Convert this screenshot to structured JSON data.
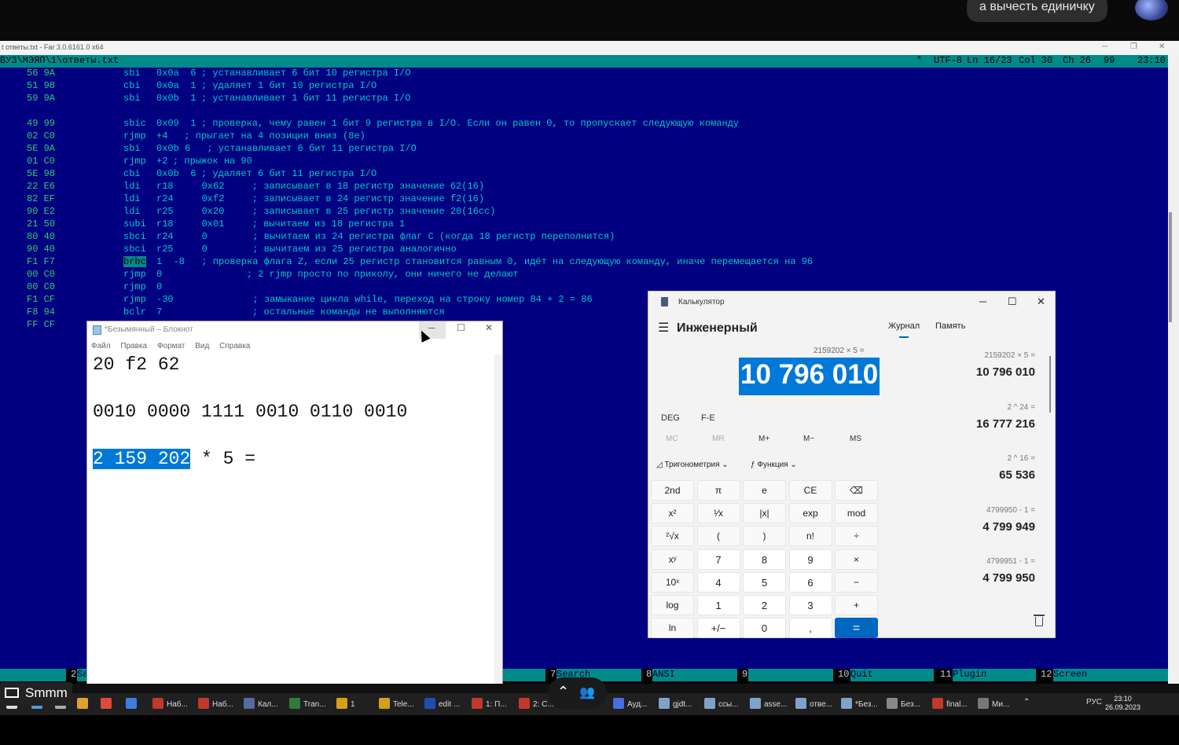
{
  "overlay": {
    "chat_text": "а вычесть единичку"
  },
  "far": {
    "window_title": "t ответы.txt - Far 3.0.6161.0 x64",
    "path": "ВУЗ\\МЭЯП\\1\\ответы.txt",
    "status": {
      "mod": "*",
      "encoding": "UTF-8",
      "line": "Ln 16/23",
      "col": "Col 30",
      "ch": "Ch 26",
      "num": "99",
      "time": "23:10"
    },
    "lines": [
      {
        "hex": "56 9A",
        "mn": "sbi",
        "ops": "0x0a  6",
        "comment": "; устанавливает 6 бит 10 регистра I/O"
      },
      {
        "hex": "51 98",
        "mn": "cbi",
        "ops": "0x0a  1",
        "comment": "; удаляет 1 бит 10 регистра I/O"
      },
      {
        "hex": "59 9A",
        "mn": "sbi",
        "ops": "0x0b  1",
        "comment": "; устанавливает 1 бит 11 регистра I/O"
      },
      {
        "hex": "",
        "mn": "",
        "ops": "",
        "comment": ""
      },
      {
        "hex": "49 99",
        "mn": "sbic",
        "ops": "0x09  1",
        "comment": "; проверка, чему равен 1 бит 9 регистра в I/O. Если он равен 0, то пропускает следующую команду"
      },
      {
        "hex": "02 C0",
        "mn": "rjmp",
        "ops": "+4",
        "comment": "  ; прыгает на 4 позиции вниз (8e)"
      },
      {
        "hex": "5E 9A",
        "mn": "sbi",
        "ops": "0x0b 6",
        "comment": "  ; устанавливает 6 бит 11 регистра I/O"
      },
      {
        "hex": "01 C0",
        "mn": "rjmp",
        "ops": "+2",
        "comment": "; прыжок на 90"
      },
      {
        "hex": "5E 98",
        "mn": "cbi",
        "ops": "0x0b  6",
        "comment": "; удаляет 6 бит 11 регистра I/O"
      },
      {
        "hex": "22 E6",
        "mn": "ldi",
        "ops": "r18     0x62",
        "comment": "    ; записывает в 18 регистр значение 62(16)"
      },
      {
        "hex": "82 EF",
        "mn": "ldi",
        "ops": "r24     0xf2",
        "comment": "    ; записывает в 24 регистр значение f2(16)"
      },
      {
        "hex": "90 E2",
        "mn": "ldi",
        "ops": "r25     0x20",
        "comment": "    ; записывает в 25 регистр значение 20(16сс)"
      },
      {
        "hex": "21 50",
        "mn": "subi",
        "ops": "r18     0x01",
        "comment": "    ; вычитаем из 18 регистра 1"
      },
      {
        "hex": "80 40",
        "mn": "sbci",
        "ops": "r24     0",
        "comment": "       ; вычитаем из 24 регистра флаг С (когда 18 регистр переполнится)"
      },
      {
        "hex": "90 40",
        "mn": "sbci",
        "ops": "r25     0",
        "comment": "       ; вычитаем из 25 регистра аналогично"
      },
      {
        "hex": "F1 F7",
        "mn": "brbc",
        "ops": "1  -8",
        "comment": "  ; проверка флага Z, если 25 регистр становится равным 0, идёт на следующую команду, иначе перемещается на 96"
      },
      {
        "hex": "00 C0",
        "mn": "rjmp",
        "ops": "0",
        "comment": "              ; 2 rjmp просто по приколу, они ничего не делают"
      },
      {
        "hex": "00 C0",
        "mn": "rjmp",
        "ops": "0",
        "comment": ""
      },
      {
        "hex": "F1 CF",
        "mn": "rjmp",
        "ops": "-30",
        "comment": "             ; замыкание цикла while, переход на строку номер 84 + 2 = 86"
      },
      {
        "hex": "F8 94",
        "mn": "bclr",
        "ops": "7",
        "comment": "               ; остальные команды не выполняются"
      },
      {
        "hex": "FF CF",
        "mn": "",
        "ops": "",
        "comment": ""
      }
    ],
    "fkeys": [
      {
        "num": "2",
        "label": "Sa"
      },
      {
        "num": "7",
        "label": "Search"
      },
      {
        "num": "8",
        "label": "ANSI"
      },
      {
        "num": "9",
        "label": ""
      },
      {
        "num": "10",
        "label": "Quit"
      },
      {
        "num": "11",
        "label": "Plugin"
      },
      {
        "num": "12",
        "label": "Screen"
      }
    ]
  },
  "notepad": {
    "title": "*Безымянный – Блокнот",
    "menu": [
      "Файл",
      "Правка",
      "Формат",
      "Вид",
      "Справка"
    ],
    "line1": "20 f2 62",
    "line2": "0010 0000 1111 0010 0110 0010",
    "line3_selected": "2 159 202",
    "line3_rest": " * 5 ="
  },
  "calculator": {
    "title": "Калькулятор",
    "mode": "Инженерный",
    "tab_history": "Журнал",
    "tab_memory": "Память",
    "expression": "2159202 × 5 =",
    "display": "10 796 010",
    "deg": "DEG",
    "fe": "F-E",
    "memory_buttons": [
      "MC",
      "MR",
      "M+",
      "M−",
      "MS"
    ],
    "trig_label": "Тригонометрия",
    "func_label": "Функция",
    "keys": [
      [
        "2nd",
        "π",
        "e",
        "CE",
        "⌫"
      ],
      [
        "x²",
        "¹⁄x",
        "|x|",
        "exp",
        "mod"
      ],
      [
        "²√x",
        "(",
        ")",
        "n!",
        "÷"
      ],
      [
        "xʸ",
        "7",
        "8",
        "9",
        "×"
      ],
      [
        "10ˣ",
        "4",
        "5",
        "6",
        "−"
      ],
      [
        "log",
        "1",
        "2",
        "3",
        "+"
      ],
      [
        "ln",
        "+/−",
        "0",
        ",",
        "="
      ]
    ],
    "history": [
      {
        "expr": "2159202  ×  5 =",
        "result": "10 796 010"
      },
      {
        "expr": "2  ^  24 =",
        "result": "16 777 216"
      },
      {
        "expr": "2  ^  16 =",
        "result": "65 536"
      },
      {
        "expr": "4799950  -  1 =",
        "result": "4 799 949"
      },
      {
        "expr": "4799951  -  1 =",
        "result": "4 799 950"
      }
    ]
  },
  "taskbar": {
    "share_label": "Smmm",
    "items": [
      "Наб...",
      "Наб...",
      "Кал...",
      "Tran...",
      "1",
      "Tele...",
      "edit ...",
      "1: П...",
      "2: C...",
      "Ауд...",
      "gjdt...",
      "ссы...",
      "asse...",
      "отве...",
      "*Без...",
      "Без...",
      "final...",
      "Ми..."
    ],
    "lang": "РУС",
    "time": "23:10",
    "date": "26.09.2023"
  }
}
